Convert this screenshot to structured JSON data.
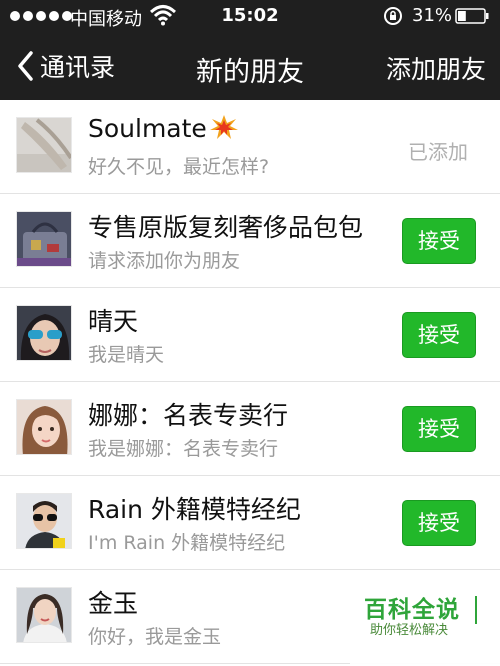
{
  "status_bar": {
    "carrier": "中国移动",
    "time": "15:02",
    "battery_percent": "31%",
    "battery_level": 0.31,
    "signal_dots": 5
  },
  "nav": {
    "back_label": "通讯录",
    "title": "新的朋友",
    "add_label": "添加朋友"
  },
  "friends": [
    {
      "name": "Soulmate",
      "message": "好久不见，最近怎样?",
      "status": "已添加"
    },
    {
      "name": "专售原版复刻奢侈品包包",
      "message": "请求添加你为朋友",
      "action": "接受"
    },
    {
      "name": "晴天",
      "message": "我是晴天",
      "action": "接受"
    },
    {
      "name": "娜娜：名表专卖行",
      "message": "我是娜娜：名表专卖行",
      "action": "接受"
    },
    {
      "name": "Rain 外籍模特经纪",
      "message": "I'm Rain 外籍模特经纪",
      "action": "接受"
    },
    {
      "name": "金玉",
      "message": "你好，我是金玉"
    }
  ],
  "watermark": {
    "brand": "百科全说",
    "tagline": "助你轻松解决"
  },
  "colors": {
    "nav_background": "#1f1f1f",
    "accept_green": "#22b82a",
    "added_gray": "#b0b0b0",
    "watermark_green": "#2fa53a"
  }
}
